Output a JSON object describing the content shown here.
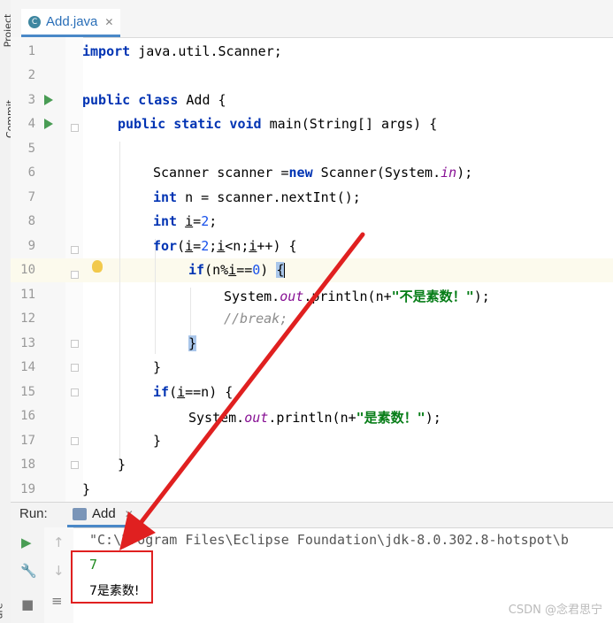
{
  "sidebar": {
    "project": "Project",
    "commit": "Commit",
    "structure": "ure"
  },
  "editor": {
    "tab_label": "Add.java",
    "tab_icon_letter": "C",
    "line_numbers": [
      "1",
      "2",
      "3",
      "4",
      "5",
      "6",
      "7",
      "8",
      "9",
      "10",
      "11",
      "12",
      "13",
      "14",
      "15",
      "16",
      "17",
      "18",
      "19"
    ]
  },
  "code": {
    "l1_a": "import",
    "l1_b": " java.util.Scanner;",
    "l3_a": "public class",
    "l3_b": " Add {",
    "l4_a": "public static void",
    "l4_b": " main(String[] args) {",
    "l6_a": "Scanner scanner =",
    "l6_b": "new",
    "l6_c": " Scanner(System.",
    "l6_d": "in",
    "l6_e": ");",
    "l7_a": "int",
    "l7_b": " n = scanner.nextInt();",
    "l8_a": "int",
    "l8_b": " ",
    "l8_c": "i",
    "l8_d": "=",
    "l8_e": "2",
    "l8_f": ";",
    "l9_a": "for",
    "l9_b": "(",
    "l9_c": "i",
    "l9_d": "=",
    "l9_e": "2",
    "l9_f": ";",
    "l9_g": "i",
    "l9_h": "<n;",
    "l9_i": "i",
    "l9_j": "++) {",
    "l10_a": "if",
    "l10_b": "(n%",
    "l10_c": "i",
    "l10_d": "==",
    "l10_e": "0",
    "l10_f": ") ",
    "l10_g": "{",
    "l11_a": "System.",
    "l11_b": "out",
    "l11_c": ".println(n+",
    "l11_d": "\"不是素数！\"",
    "l11_e": ");",
    "l12_a": "//break;",
    "l13_a": "}",
    "l14_a": "}",
    "l15_a": "if",
    "l15_b": "(",
    "l15_c": "i",
    "l15_d": "==n) {",
    "l16_a": "System.",
    "l16_b": "out",
    "l16_c": ".println(n+",
    "l16_d": "\"是素数！\"",
    "l16_e": ");",
    "l17_a": "}",
    "l18_a": "}",
    "l19_a": "}"
  },
  "run": {
    "title": "Run:",
    "tab_label": "Add",
    "console_path": "\"C:\\Program Files\\Eclipse Foundation\\jdk-8.0.302.8-hotspot\\b",
    "input_value": "7",
    "output_text": "7是素数!"
  },
  "watermark": "CSDN @念君思宁",
  "colors": {
    "keyword": "#0033b3",
    "string": "#067d17",
    "number": "#1750eb",
    "annotation_red": "#e02020",
    "run_green": "#499c54"
  }
}
